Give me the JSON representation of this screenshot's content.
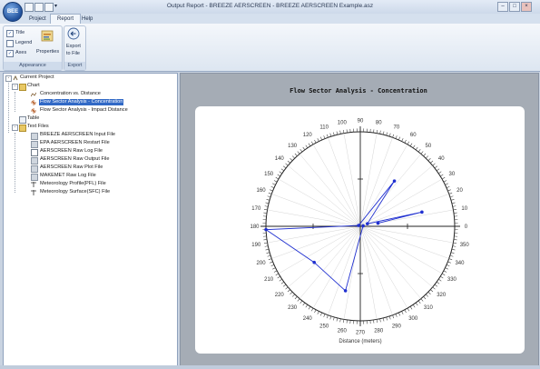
{
  "window": {
    "title": "Output Report - BREEZE AERSCREEN - BREEZE AERSCREEN Example.asz",
    "app_button": "BEE",
    "controls": {
      "minimize": "–",
      "restore": "□",
      "close": "×"
    }
  },
  "tabs": [
    {
      "label": "Project",
      "active": false
    },
    {
      "label": "Report",
      "active": true
    },
    {
      "label": "Help",
      "active": false
    }
  ],
  "ribbon": {
    "appearance": {
      "group_label": "Appearance",
      "title_label": "Title",
      "title_checked": true,
      "legend_label": "Legend",
      "legend_checked": false,
      "axes_label": "Axes",
      "axes_checked": true,
      "properties_label": "Properties"
    },
    "export": {
      "group_label": "Export",
      "button_line1": "Export",
      "button_line2": "to File"
    }
  },
  "tree": {
    "root": "Current Project",
    "chart_folder": "Chart",
    "chart_items": [
      "Concentration vs. Distance",
      "Flow Sector Analysis - Concentration",
      "Flow Sector Analysis - Impact Distance"
    ],
    "selected_index": 1,
    "table": "Table",
    "text_folder": "Text Files",
    "text_items": [
      "BREEZE AERSCREEN Input File",
      "EPA AERSCREEN Restart File",
      "AERSCREEN Raw Log File",
      "AERSCREEN Raw Output File",
      "AERSCREEN Raw Plot File",
      "MAKEMET Raw Log File",
      "Meteorology Profile(PFL) File",
      "Meteorology Surface(SFC) File"
    ]
  },
  "chart_data": {
    "type": "polar-line",
    "title": "Flow Sector Analysis - Concentration",
    "xlabel": "Distance (meters)",
    "angle_ticks": [
      0,
      10,
      20,
      30,
      40,
      50,
      60,
      70,
      80,
      90,
      100,
      110,
      120,
      130,
      140,
      150,
      160,
      170,
      180,
      190,
      200,
      210,
      220,
      230,
      240,
      250,
      260,
      270,
      280,
      290,
      300,
      310,
      320,
      330,
      340,
      350
    ],
    "radius_range": [
      0,
      1
    ],
    "series": [
      {
        "color": "#1f2fd0",
        "points": [
          {
            "angle": 10,
            "r": 0.19
          },
          {
            "angle": 13,
            "r": 0.67
          },
          {
            "angle": 20,
            "r": 0.08
          },
          {
            "angle": 53,
            "r": 0.6
          },
          {
            "angle": 154,
            "r": 0.02
          },
          {
            "angle": 182,
            "r": 1.0
          },
          {
            "angle": 218,
            "r": 0.62
          },
          {
            "angle": 257,
            "r": 0.7
          },
          {
            "angle": 10,
            "r": 0.03
          }
        ]
      }
    ]
  },
  "colors": {
    "accent": "#3169c6",
    "series": "#1f2fd0"
  }
}
